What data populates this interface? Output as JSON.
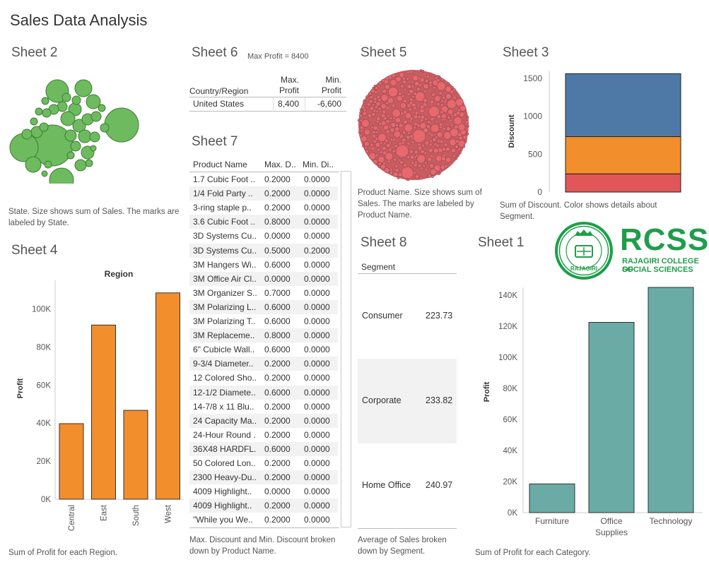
{
  "dashboard_title": "Sales Data Analysis",
  "sheet2": {
    "title": "Sheet 2",
    "caption": "State.  Size shows sum of Sales.  The marks are labeled by State.",
    "color": "#6dbb5e"
  },
  "sheet6": {
    "title": "Sheet 6",
    "subtitle": "Max Profit = 8400",
    "col_country": "Country/Region",
    "col_max_1": "Max.",
    "col_max_2": "Profit",
    "col_min_1": "Min.",
    "col_min_2": "Profit",
    "row": {
      "country": "United States",
      "max": "8,400",
      "min": "-6,600"
    }
  },
  "sheet5": {
    "title": "Sheet 5",
    "caption": "Product Name.  Size shows sum of Sales.  The marks are labeled by Product Name.",
    "color": "#e8686d"
  },
  "sheet3": {
    "title": "Sheet 3",
    "caption": "Sum of Discount.  Color shows details about Segment."
  },
  "sheet7": {
    "title": "Sheet 7",
    "col_product": "Product Name",
    "col_max": "Max. D..",
    "col_min": "Min. Di..",
    "rows": [
      [
        "1.7 Cubic Foot ..",
        "0.2000",
        "0.0000"
      ],
      [
        "1/4 Fold Party ..",
        "0.2000",
        "0.0000"
      ],
      [
        "3-ring staple p..",
        "0.2000",
        "0.0000"
      ],
      [
        "3.6 Cubic Foot ..",
        "0.8000",
        "0.0000"
      ],
      [
        "3D Systems Cu..",
        "0.0000",
        "0.0000"
      ],
      [
        "3D Systems Cu..",
        "0.5000",
        "0.2000"
      ],
      [
        "3M Hangers Wi..",
        "0.6000",
        "0.0000"
      ],
      [
        "3M Office Air Cl..",
        "0.0000",
        "0.0000"
      ],
      [
        "3M Organizer S..",
        "0.7000",
        "0.0000"
      ],
      [
        "3M Polarizing L..",
        "0.6000",
        "0.0000"
      ],
      [
        "3M Polarizing T..",
        "0.6000",
        "0.0000"
      ],
      [
        "3M Replaceme..",
        "0.8000",
        "0.0000"
      ],
      [
        "6\" Cubicle Wall..",
        "0.6000",
        "0.0000"
      ],
      [
        "9-3/4 Diameter..",
        "0.2000",
        "0.0000"
      ],
      [
        "12 Colored Sho..",
        "0.2000",
        "0.0000"
      ],
      [
        "12-1/2 Diamete..",
        "0.6000",
        "0.0000"
      ],
      [
        "14-7/8 x 11 Blu..",
        "0.2000",
        "0.0000"
      ],
      [
        "24 Capacity Ma..",
        "0.2000",
        "0.0000"
      ],
      [
        "24-Hour Round ..",
        "0.2000",
        "0.0000"
      ],
      [
        "36X48 HARDFL..",
        "0.6000",
        "0.0000"
      ],
      [
        "50 Colored Lon..",
        "0.2000",
        "0.0000"
      ],
      [
        "2300 Heavy-Du..",
        "0.2000",
        "0.0000"
      ],
      [
        "4009 Highlight..",
        "0.0000",
        "0.0000"
      ],
      [
        "4009 Highlight..",
        "0.2000",
        "0.0000"
      ],
      [
        "\"While you We..",
        "0.2000",
        "0.0000"
      ]
    ],
    "caption": "Max. Discount and Min. Discount broken down by Product Name."
  },
  "sheet8": {
    "title": "Sheet 8",
    "col_segment": "Segment",
    "rows": [
      {
        "segment": "Consumer",
        "value": "223.73"
      },
      {
        "segment": "Corporate",
        "value": "233.82"
      },
      {
        "segment": "Home Office",
        "value": "240.97"
      }
    ],
    "caption": "Average of Sales broken down by Segment."
  },
  "sheet4": {
    "title": "Sheet 4",
    "caption": "Sum of Profit for each Region."
  },
  "sheet1": {
    "title": "Sheet 1",
    "caption": "Sum of Profit for each Category."
  },
  "logo": {
    "name": "RCSS",
    "line1": "RAJAGIRI COLLEGE OF",
    "line2": "SOCIAL SCIENCES",
    "seal_text": "RAJAGIRI",
    "color": "#1e9e4a"
  },
  "chart_data": [
    {
      "id": "sheet3",
      "type": "bar",
      "stacked": true,
      "ylabel": "Discount",
      "ylim": [
        0,
        1600
      ],
      "yticks": [
        "0",
        "500",
        "1000",
        "1500"
      ],
      "series": [
        {
          "value": 240,
          "color": "#e15759"
        },
        {
          "value": 490,
          "color": "#f28e2b"
        },
        {
          "value": 830,
          "color": "#4e79a7"
        }
      ]
    },
    {
      "id": "sheet4",
      "type": "bar",
      "title": "Region",
      "ylabel": "Profit",
      "categories": [
        "Central",
        "East",
        "South",
        "West"
      ],
      "values": [
        39700,
        91500,
        46700,
        108400
      ],
      "ylim": [
        0,
        115000
      ],
      "yticks": [
        "0K",
        "20K",
        "40K",
        "60K",
        "80K",
        "100K"
      ],
      "color": "#f28e2b"
    },
    {
      "id": "sheet1",
      "type": "bar",
      "ylabel": "Profit",
      "categories": [
        "Furniture",
        "Office Supplies",
        "Technology"
      ],
      "values": [
        18500,
        122500,
        145500
      ],
      "ylim": [
        0,
        145000
      ],
      "yticks": [
        "0K",
        "20K",
        "40K",
        "60K",
        "80K",
        "100K",
        "120K",
        "140K"
      ],
      "color": "#6aaba5"
    }
  ]
}
